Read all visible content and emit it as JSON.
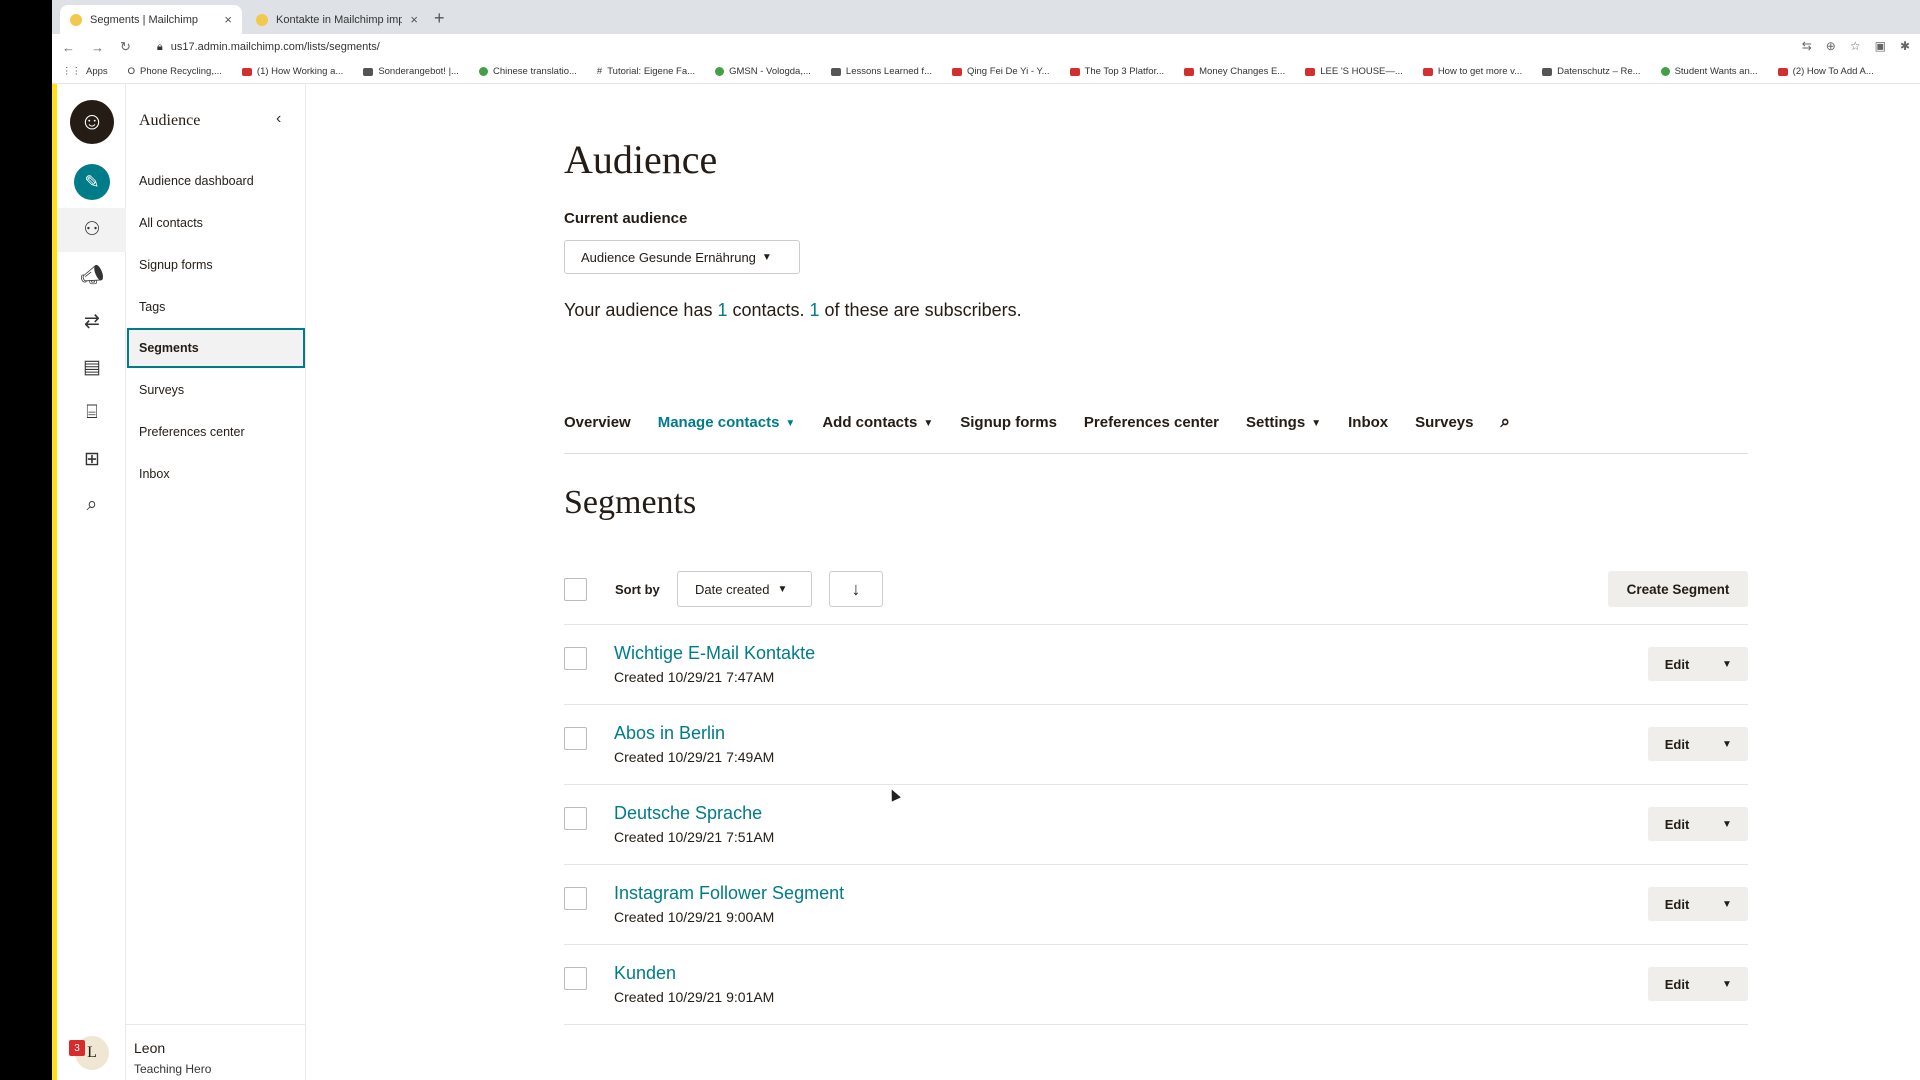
{
  "browser": {
    "tabs": [
      {
        "title": "Segments | Mailchimp",
        "close": "×"
      },
      {
        "title": "Kontakte in Mailchimp importi…",
        "close": "×"
      }
    ],
    "new_tab": "+",
    "url": "us17.admin.mailchimp.com/lists/segments/",
    "bookmarks": [
      "Apps",
      "Phone Recycling,...",
      "(1) How Working a...",
      "Sonderangebot! |...",
      "Chinese translatio...",
      "Tutorial: Eigene Fa...",
      "GMSN - Vologda,...",
      "Lessons Learned f...",
      "Qing Fei De Yi - Y...",
      "The Top 3 Platfor...",
      "Money Changes E...",
      "LEE 'S HOUSE—...",
      "How to get more v...",
      "Datenschutz – Re...",
      "Student Wants an...",
      "(2) How To Add A..."
    ]
  },
  "sidebar": {
    "title": "Audience",
    "items": [
      {
        "label": "Audience dashboard"
      },
      {
        "label": "All contacts"
      },
      {
        "label": "Signup forms"
      },
      {
        "label": "Tags"
      },
      {
        "label": "Segments",
        "active": true
      },
      {
        "label": "Surveys"
      },
      {
        "label": "Preferences center"
      },
      {
        "label": "Inbox"
      }
    ],
    "user": {
      "name": "Leon",
      "subtitle": "Teaching Hero",
      "initial": "L",
      "notifications": "3"
    }
  },
  "main": {
    "title": "Audience",
    "current_audience_label": "Current audience",
    "audience_select": "Audience Gesunde Ernährung",
    "summary": {
      "p1": "Your audience has ",
      "contacts": "1",
      "p2": " contacts. ",
      "subscribers": "1",
      "p3": " of these are subscribers."
    },
    "tabs": [
      {
        "label": "Overview"
      },
      {
        "label": "Manage contacts"
      },
      {
        "label": "Add contacts"
      },
      {
        "label": "Signup forms"
      },
      {
        "label": "Preferences center"
      },
      {
        "label": "Settings"
      },
      {
        "label": "Inbox"
      },
      {
        "label": "Surveys"
      }
    ],
    "section_title": "Segments",
    "sort_label": "Sort by",
    "sort_value": "Date created",
    "create_button": "Create Segment",
    "segments": [
      {
        "name": "Wichtige E-Mail Kontakte",
        "created": "Created 10/29/21 7:47AM",
        "edit": "Edit"
      },
      {
        "name": "Abos in Berlin",
        "created": "Created 10/29/21 7:49AM",
        "edit": "Edit"
      },
      {
        "name": "Deutsche Sprache",
        "created": "Created 10/29/21 7:51AM",
        "edit": "Edit"
      },
      {
        "name": "Instagram Follower Segment",
        "created": "Created 10/29/21 9:00AM",
        "edit": "Edit"
      },
      {
        "name": "Kunden",
        "created": "Created 10/29/21 9:01AM",
        "edit": "Edit"
      }
    ]
  },
  "colors": {
    "accent": "#007c89",
    "brand_yellow": "#ffe01b",
    "text": "#241c15"
  }
}
